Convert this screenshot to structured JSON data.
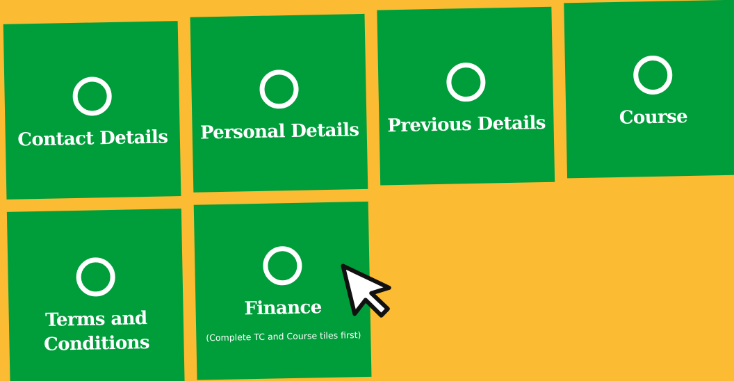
{
  "tiles": [
    {
      "label": "Contact Details",
      "status_icon": "empty-circle-icon"
    },
    {
      "label": "Personal Details",
      "status_icon": "empty-circle-icon"
    },
    {
      "label": "Previous Details",
      "status_icon": "empty-circle-icon"
    },
    {
      "label": "Course",
      "status_icon": "empty-circle-icon"
    },
    {
      "label": "Terms and Conditions",
      "status_icon": "empty-circle-icon"
    },
    {
      "label": "Finance",
      "note": "(Complete TC and Course tiles first)",
      "status_icon": "empty-circle-icon"
    }
  ],
  "pointer_icon": "arrow-cursor-icon",
  "colors": {
    "background": "#fbbb32",
    "tile": "#009e3a",
    "text": "#ffffff"
  }
}
